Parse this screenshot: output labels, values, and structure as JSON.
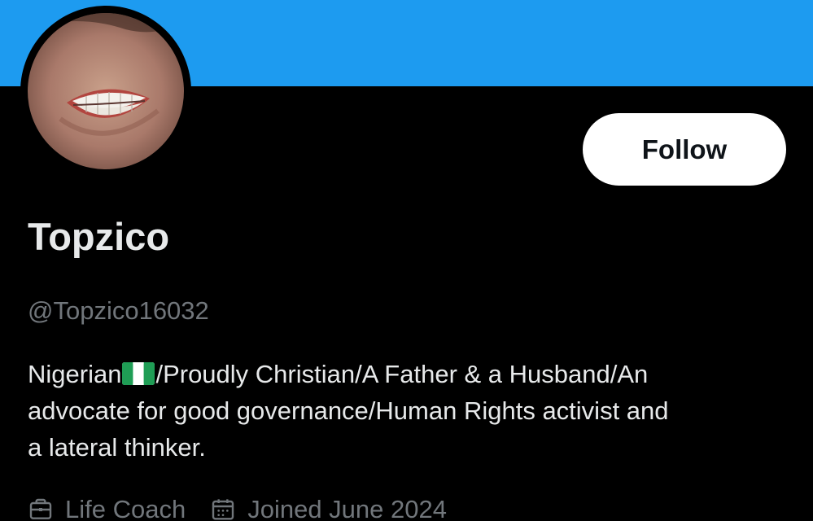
{
  "colors": {
    "banner": "#1d9bf0",
    "background": "#000000",
    "primary_text": "#e7e9ea",
    "secondary_text": "#71767b",
    "follow_button_bg": "#ffffff",
    "follow_button_text": "#0f1419"
  },
  "profile": {
    "avatar_icon": "profile-photo-teeth-closeup",
    "display_name": "Topzico",
    "handle": "@Topzico16032",
    "follow_label": "Follow",
    "bio": {
      "line1_before_flag": "Nigerian",
      "flag_icon": "nigeria-flag-icon",
      "line1_after_flag": "/Proudly Christian/A Father & a Husband/An",
      "line2": "advocate for good governance/Human Rights activist and",
      "line3": "a lateral thinker."
    },
    "meta": {
      "category_icon": "briefcase-icon",
      "category": "Life Coach",
      "joined_icon": "calendar-icon",
      "joined": "Joined June 2024"
    }
  }
}
